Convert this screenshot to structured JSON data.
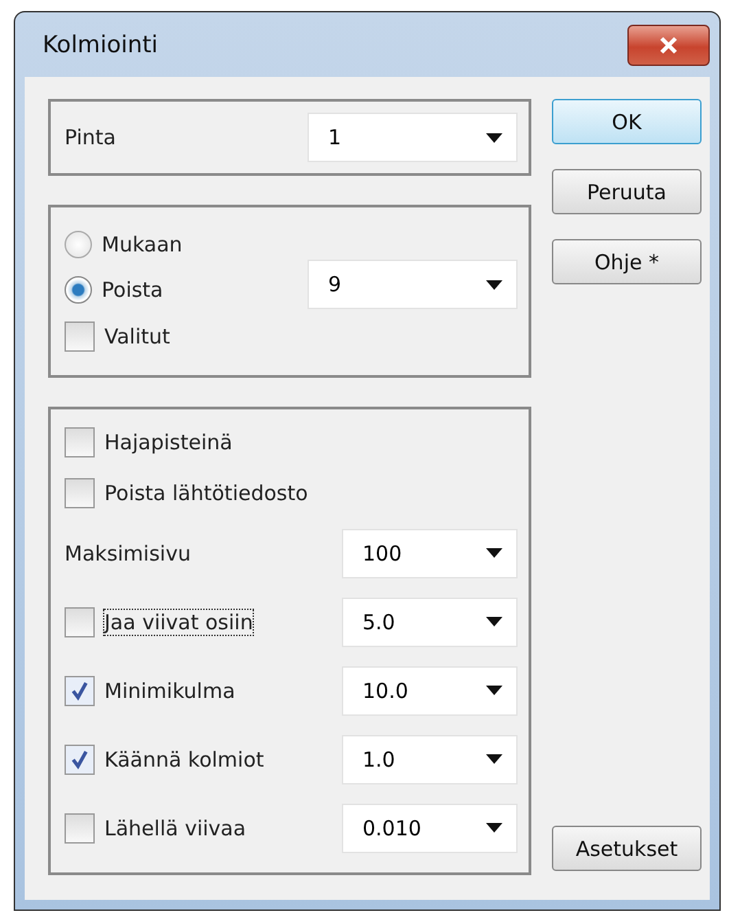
{
  "window": {
    "title": "Kolmiointi"
  },
  "surface": {
    "label": "Pinta",
    "value": "1"
  },
  "mode": {
    "options": [
      {
        "label": "Mukaan",
        "selected": false
      },
      {
        "label": "Poista",
        "selected": true
      }
    ],
    "value": "9",
    "selected_only": {
      "label": "Valitut",
      "checked": false
    }
  },
  "options": [
    {
      "kind": "checkbox",
      "label": "Hajapisteinä",
      "checked": false,
      "focused": false
    },
    {
      "kind": "checkbox",
      "label": "Poista lähtötiedosto",
      "checked": false,
      "focused": false
    },
    {
      "kind": "field",
      "label": "Maksimisivu",
      "value": "100"
    },
    {
      "kind": "checkbox",
      "label": "Jaa viivat osiin",
      "checked": false,
      "focused": true,
      "value": "5.0"
    },
    {
      "kind": "checkbox",
      "label": "Minimikulma",
      "checked": true,
      "focused": false,
      "value": "10.0"
    },
    {
      "kind": "checkbox",
      "label": "Käännä kolmiot",
      "checked": true,
      "focused": false,
      "value": "1.0"
    },
    {
      "kind": "checkbox",
      "label": "Lähellä viivaa",
      "checked": false,
      "focused": false,
      "value": "0.010"
    }
  ],
  "buttons": [
    "OK",
    "Peruuta",
    "Ohje *"
  ],
  "settings_button": "Asetukset"
}
